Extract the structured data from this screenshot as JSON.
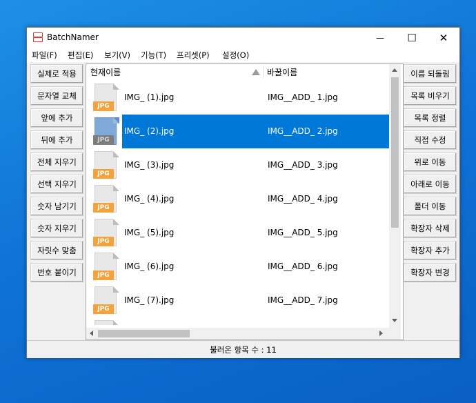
{
  "window": {
    "title": "BatchNamer",
    "minimize": "—",
    "maximize": "☐",
    "close": "✕"
  },
  "menu": [
    "파일(F)",
    "편집(E)",
    "보기(V)",
    "기능(T)",
    "프리셋(P)",
    "설정(O)"
  ],
  "left_buttons": [
    "실제로 적용",
    "문자열 교체",
    "앞에 추가",
    "뒤에 추가",
    "전체 지우기",
    "선택 지우기",
    "숫자 남기기",
    "숫자 지우기",
    "자릿수 맞춤",
    "번호 붙이기"
  ],
  "right_buttons": [
    "이름 되돌림",
    "목록 비우기",
    "목록 정렬",
    "직접 수정",
    "위로 이동",
    "아래로 이동",
    "폴더 이동",
    "확장자 삭제",
    "확장자 추가",
    "확장자 변경"
  ],
  "list": {
    "headers": {
      "current": "현재이름",
      "new": "바꿀이름"
    },
    "thumb_label": "JPG",
    "selected_index": 1,
    "rows": [
      {
        "current": "IMG_ (1).jpg",
        "new": "IMG__ADD_ 1.jpg"
      },
      {
        "current": "IMG_ (2).jpg",
        "new": "IMG__ADD_ 2.jpg"
      },
      {
        "current": "IMG_ (3).jpg",
        "new": "IMG__ADD_ 3.jpg"
      },
      {
        "current": "IMG_ (4).jpg",
        "new": "IMG__ADD_ 4.jpg"
      },
      {
        "current": "IMG_ (5).jpg",
        "new": "IMG__ADD_ 5.jpg"
      },
      {
        "current": "IMG_ (6).jpg",
        "new": "IMG__ADD_ 6.jpg"
      },
      {
        "current": "IMG_ (7).jpg",
        "new": "IMG__ADD_ 7.jpg"
      }
    ]
  },
  "status": {
    "text": "불러온 항목 수 : 11"
  },
  "colors": {
    "selection": "#0078d7",
    "jpg_tag": "#f5a23a",
    "desktop": "#0f74d6"
  }
}
